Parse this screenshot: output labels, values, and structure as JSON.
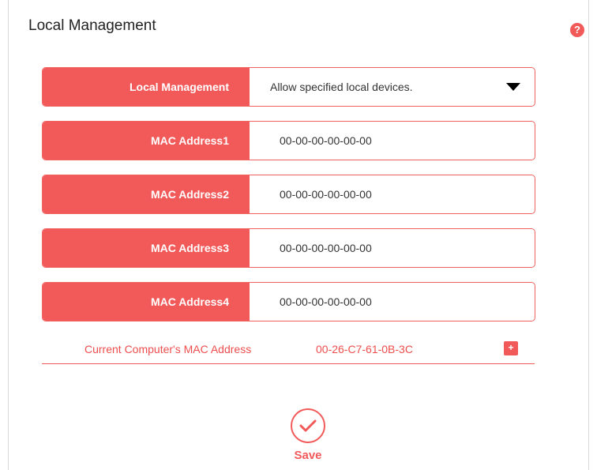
{
  "page": {
    "title": "Local Management",
    "help_icon": "?"
  },
  "settings": {
    "local_management": {
      "label": "Local Management",
      "selected": "Allow specified local devices."
    },
    "mac_fields": [
      {
        "label": "MAC Address1",
        "value": "00-00-00-00-00-00"
      },
      {
        "label": "MAC Address2",
        "value": "00-00-00-00-00-00"
      },
      {
        "label": "MAC Address3",
        "value": "00-00-00-00-00-00"
      },
      {
        "label": "MAC Address4",
        "value": "00-00-00-00-00-00"
      }
    ],
    "current_mac": {
      "label": "Current Computer's MAC Address",
      "value": "00-26-C7-61-0B-3C",
      "add_symbol": "+"
    }
  },
  "actions": {
    "save_label": "Save"
  },
  "colors": {
    "accent": "#f25a5a",
    "text": "#333333"
  },
  "icons": {
    "help": "question-circle-icon",
    "dropdown": "caret-down-icon",
    "add": "plus-icon",
    "save": "check-circle-icon"
  }
}
